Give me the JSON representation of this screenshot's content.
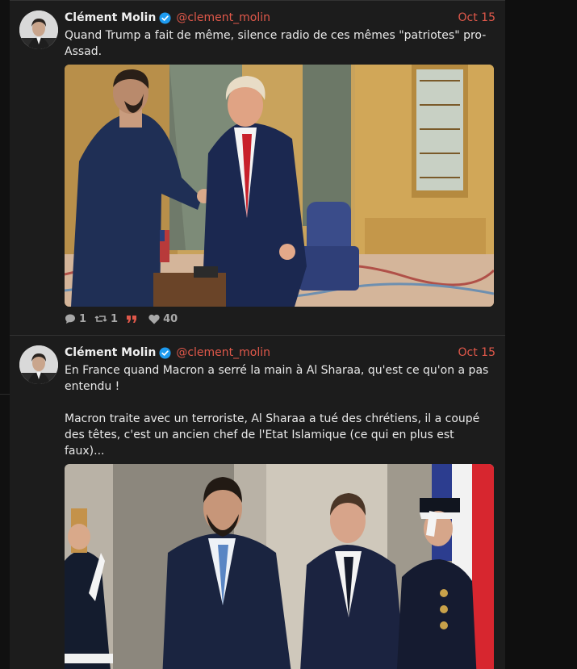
{
  "posts": [
    {
      "author": "Clément Molin",
      "handle": "@clement_molin",
      "date": "Oct 15",
      "text": "Quand Trump a fait de même, silence radio de ces mêmes \"patriotes\" pro-Assad.",
      "actions": {
        "replies": "1",
        "reposts": "1",
        "likes": "40"
      }
    },
    {
      "author": "Clément Molin",
      "handle": "@clement_molin",
      "date": "Oct 15",
      "text": "En France quand Macron a serré la main à Al Sharaa, qu'est ce qu'on a pas entendu !\n\nMacron traite avec un terroriste, Al Sharaa a tué des chrétiens, il a coupé des têtes, c'est un ancien chef de l'Etat Islamique (ce qui en plus est faux)..."
    }
  ],
  "colors": {
    "accent": "#e0584a",
    "verified": "#1d9bf0",
    "background": "#1c1c1c"
  },
  "icons": [
    "verified-badge-icon",
    "reply-icon",
    "repost-icon",
    "quote-icon",
    "heart-icon"
  ]
}
